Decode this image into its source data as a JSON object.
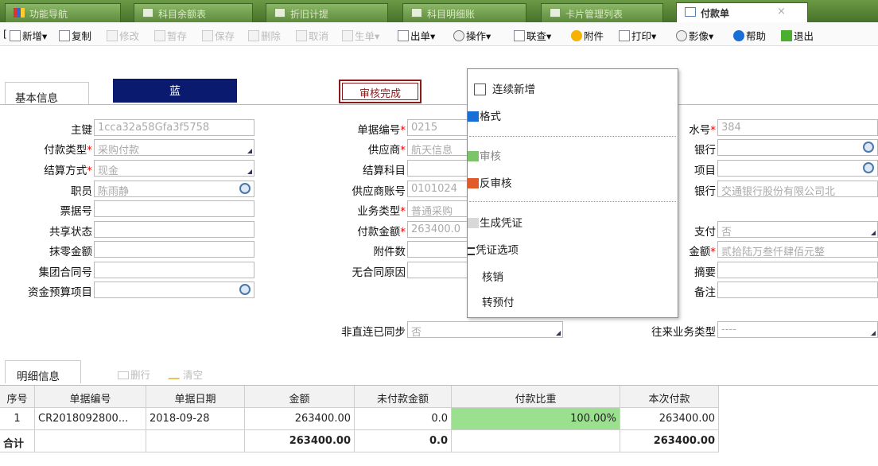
{
  "tabs": [
    {
      "label": "功能导航"
    },
    {
      "label": "科目余额表"
    },
    {
      "label": "折旧计提"
    },
    {
      "label": "科目明细账"
    },
    {
      "label": "卡片管理列表"
    },
    {
      "label": "付款单",
      "close": "×"
    }
  ],
  "toolbar": {
    "lead": "[",
    "new": "新增▾",
    "copy": "复制",
    "edit": "修改",
    "stage": "暂存",
    "save": "保存",
    "delete": "删除",
    "cancel": "取消",
    "gen": "生单▾",
    "outbill": "出单▾",
    "ops": "操作▾",
    "linkquery": "联查▾",
    "attach": "附件",
    "print": "打印▾",
    "image": "影像▾",
    "help": "帮助",
    "exit": "退出"
  },
  "header": {
    "section_label": "基本信息",
    "color_box": "蓝",
    "stamp": "审核完成"
  },
  "form": {
    "pk_label": "主键",
    "pk_value": "1cca32a58Gfa3f5758",
    "paytype_label": "付款类型",
    "paytype_value": "采购付款",
    "settle_label": "结算方式",
    "settle_value": "现金",
    "staff_label": "职员",
    "staff_value": "陈雨静",
    "ticket_label": "票据号",
    "ticket_value": "",
    "share_label": "共享状态",
    "share_value": "",
    "wipe_label": "抹零金额",
    "wipe_value": "",
    "group_contract_label": "集团合同号",
    "group_contract_value": "",
    "budget_label": "资金预算项目",
    "budget_value": "",
    "billno_label": "单据编号",
    "billno_value": "0215",
    "supplier_label": "供应商",
    "supplier_value": "航天信息",
    "subject_label": "结算科目",
    "subject_value": "",
    "supacct_label": "供应商账号",
    "supacct_value": "0101024",
    "biztype_label": "业务类型",
    "biztype_value": "普通采购",
    "payamt_label": "付款金额",
    "payamt_value": "263400.0",
    "attcount_label": "附件数",
    "attcount_value": "",
    "nocontract_label": "无合同原因",
    "nocontract_value": "",
    "nondirect_label": "非直连已同步",
    "nondirect_value": "否",
    "serial_label": "水号",
    "serial_value": "384",
    "bank_label": "银行",
    "bank_value": "",
    "project_label": "项目",
    "project_value": "",
    "pbank_label": "银行",
    "pbank_value": "交通银行股份有限公司北",
    "payon_label": "支付",
    "payon_value": "否",
    "capamt_label": "金额",
    "capamt_value": "贰拾陆万叁仟肆佰元整",
    "summary_label": "摘要",
    "summary_value": "",
    "remark_label": "备注",
    "remark_value": "",
    "bizcat_label": "往来业务类型",
    "bizcat_value": "----"
  },
  "dropdown": {
    "continuous": "连续新增",
    "format": "格式",
    "audit": "审核",
    "unaudit": "反审核",
    "voucher": "生成凭证",
    "voucher_opt": "凭证选项",
    "writeoff": "核销",
    "prepay": "转预付"
  },
  "detail": {
    "tab_label": "明细信息",
    "del_label": "删行",
    "clear_label": "清空",
    "columns": [
      "序号",
      "单据编号",
      "单据日期",
      "金额",
      "未付款金额",
      "付款比重",
      "本次付款"
    ],
    "rows": [
      {
        "seq": "1",
        "billno": "CR2018092800...",
        "date": "2018-09-28",
        "amount": "263400.00",
        "unpaid": "0.0",
        "ratio": "100.00%",
        "pay": "263400.00"
      }
    ],
    "total": {
      "label": "合计",
      "amount": "263400.00",
      "unpaid": "0.0",
      "pay": "263400.00"
    }
  },
  "colors": {
    "accent": "#47712a",
    "ratio_cell": "#9be08f",
    "stamp": "#8b1a1a",
    "color_box": "#0a1a6e"
  }
}
